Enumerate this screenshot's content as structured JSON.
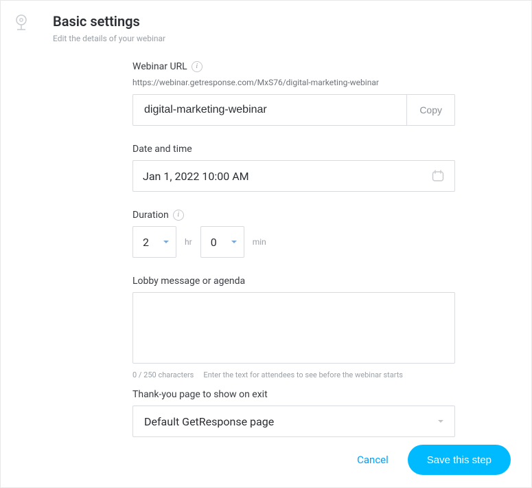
{
  "header": {
    "title": "Basic settings",
    "subtitle": "Edit the details of your webinar"
  },
  "url": {
    "label": "Webinar URL",
    "full": "https://webinar.getresponse.com/MxS76/digital-marketing-webinar",
    "value": "digital-marketing-webinar",
    "copy_label": "Copy"
  },
  "datetime": {
    "label": "Date and time",
    "value": "Jan 1, 2022 10:00 AM"
  },
  "duration": {
    "label": "Duration",
    "hours": "2",
    "hours_unit": "hr",
    "minutes": "0",
    "minutes_unit": "min"
  },
  "lobby": {
    "label": "Lobby message or agenda",
    "value": "",
    "counter": "0 / 250 characters",
    "hint": "Enter the text for attendees to see before the webinar starts"
  },
  "thankyou": {
    "label": "Thank-you page to show on exit",
    "value": "Default GetResponse page"
  },
  "footer": {
    "cancel": "Cancel",
    "save": "Save this step"
  }
}
